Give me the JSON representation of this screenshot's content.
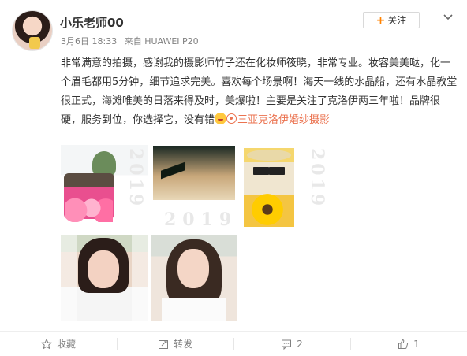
{
  "user": {
    "name": "小乐老师00",
    "date": "3月6日 18:33",
    "source": "来自 HUAWEI P20"
  },
  "follow": {
    "label": "关注"
  },
  "post": {
    "text": "非常满意的拍摄，感谢我的摄影师竹子还在化妆师筱晓，非常专业。妆容美美哒，化一个眉毛都用5分钟，细节追求完美。喜欢每个场景啊！海天一线的水晶船，还有水晶教堂很正式，海滩唯美的日落来得及时，美爆啦！主要是关注了克洛伊两三年啦！品牌很硬，服务到位，你选择它，没有错",
    "mention": "三亚克洛伊婚纱摄影"
  },
  "photos": {
    "watermark_year": "2019"
  },
  "actions": {
    "favorite": "收藏",
    "repost": "转发",
    "comments": "2",
    "likes": "1"
  },
  "colors": {
    "accent": "#ff8200",
    "link": "#eb7350",
    "meta_text": "#808080"
  }
}
